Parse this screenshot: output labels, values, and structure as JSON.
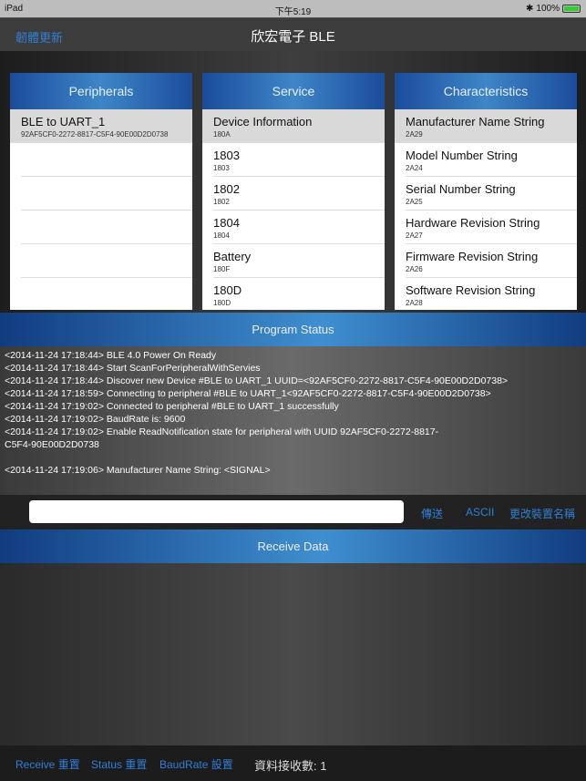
{
  "status_bar": {
    "device": "iPad",
    "time": "下午5:19",
    "battery": "100%",
    "battery_level": 100
  },
  "nav": {
    "back": "韌體更新",
    "title": "欣宏電子 BLE"
  },
  "peripherals": {
    "title": "Peripherals",
    "items": [
      {
        "name": "BLE to UART_1",
        "sub": "92AF5CF0-2272-8817-C5F4-90E00D2D0738"
      },
      {
        "name": "",
        "sub": ""
      },
      {
        "name": "",
        "sub": ""
      },
      {
        "name": "",
        "sub": ""
      },
      {
        "name": "",
        "sub": ""
      },
      {
        "name": "",
        "sub": ""
      }
    ]
  },
  "service": {
    "title": "Service",
    "items": [
      {
        "name": "Device Information",
        "sub": "180A"
      },
      {
        "name": "1803",
        "sub": "1803"
      },
      {
        "name": "1802",
        "sub": "1802"
      },
      {
        "name": "1804",
        "sub": "1804"
      },
      {
        "name": "Battery",
        "sub": "180F"
      },
      {
        "name": "180D",
        "sub": "180D"
      }
    ]
  },
  "characteristics": {
    "title": "Characteristics",
    "items": [
      {
        "name": "Manufacturer Name String",
        "sub": "2A29"
      },
      {
        "name": "Model Number String",
        "sub": "2A24"
      },
      {
        "name": "Serial Number String",
        "sub": "2A25"
      },
      {
        "name": "Hardware Revision String",
        "sub": "2A27"
      },
      {
        "name": "Firmware Revision String",
        "sub": "2A26"
      },
      {
        "name": "Software Revision String",
        "sub": "2A28"
      }
    ]
  },
  "program_status": {
    "title": "Program Status",
    "log": "<2014-11-24 17:18:44> BLE 4.0 Power On Ready\n<2014-11-24 17:18:44> Start ScanForPeripheralWithServies\n<2014-11-24 17:18:44> Discover new Device #BLE to UART_1 UUID=<92AF5CF0-2272-8817-C5F4-90E00D2D0738>\n<2014-11-24 17:18:59> Connecting to peripheral #BLE to UART_1<92AF5CF0-2272-8817-C5F4-90E00D2D0738>\n<2014-11-24 17:19:02> Connected to peripheral #BLE to UART_1 successfully\n<2014-11-24 17:19:02> BaudRate is: 9600\n<2014-11-24 17:19:02> Enable ReadNotification state for peripheral with UUID 92AF5CF0-2272-8817-\nC5F4-90E00D2D0738\n\n<2014-11-24 17:19:06> Manufacturer Name String: <SIGNAL>"
  },
  "input": {
    "value": "",
    "send": "傳送",
    "ascii": "ASCII",
    "rename": "更改裝置名稱"
  },
  "receive": {
    "title": "Receive Data",
    "content": ""
  },
  "bottom": {
    "receive_reset": "Receive 重置",
    "status_reset": "Status 重置",
    "baudrate": "BaudRate 設置",
    "count": "資料接收數: 1"
  }
}
